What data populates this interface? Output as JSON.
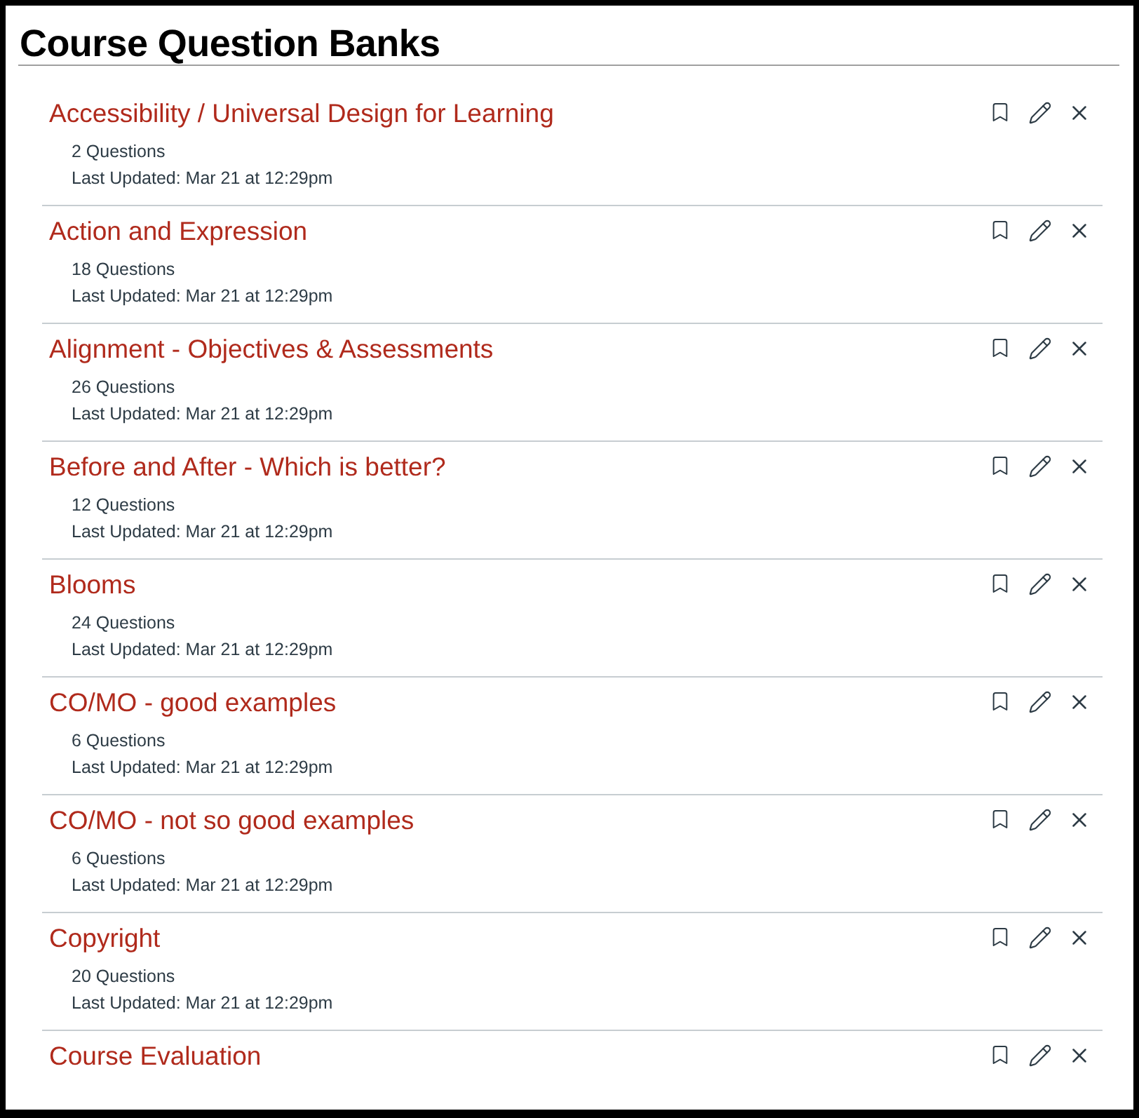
{
  "page_title": "Course Question Banks",
  "banks": [
    {
      "title": "Accessibility / Universal Design for Learning",
      "questions": "2 Questions",
      "updated": "Last Updated: Mar 21 at 12:29pm"
    },
    {
      "title": "Action and Expression",
      "questions": "18 Questions",
      "updated": "Last Updated: Mar 21 at 12:29pm"
    },
    {
      "title": "Alignment - Objectives & Assessments",
      "questions": "26 Questions",
      "updated": "Last Updated: Mar 21 at 12:29pm"
    },
    {
      "title": "Before and After - Which is better?",
      "questions": "12 Questions",
      "updated": "Last Updated: Mar 21 at 12:29pm"
    },
    {
      "title": "Blooms",
      "questions": "24 Questions",
      "updated": "Last Updated: Mar 21 at 12:29pm"
    },
    {
      "title": "CO/MO - good examples",
      "questions": "6 Questions",
      "updated": "Last Updated: Mar 21 at 12:29pm"
    },
    {
      "title": "CO/MO - not so good examples",
      "questions": "6 Questions",
      "updated": "Last Updated: Mar 21 at 12:29pm"
    },
    {
      "title": "Copyright",
      "questions": "20 Questions",
      "updated": "Last Updated: Mar 21 at 12:29pm"
    },
    {
      "title": "Course Evaluation"
    }
  ]
}
